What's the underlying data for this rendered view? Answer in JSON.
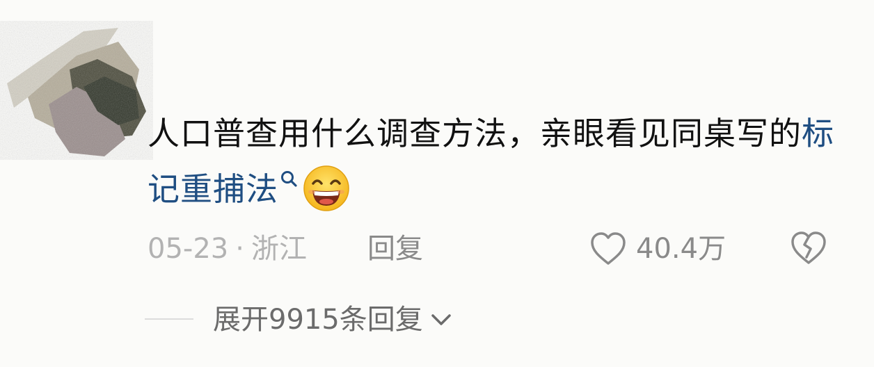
{
  "comment": {
    "text_before": "人口普查用什么调查方法，亲眼看见同桌写的",
    "link_text": "标记重捕法",
    "link_icon": "search-icon",
    "emoji": "grinning-face-emoji"
  },
  "meta": {
    "date": "05-23",
    "separator": "·",
    "location": "浙江"
  },
  "actions": {
    "reply_label": "回复",
    "like_icon": "heart-outline-icon",
    "like_count": "40.4万",
    "dislike_icon": "broken-heart-icon"
  },
  "replies": {
    "expand_label": "展开9915条回复",
    "expand_icon": "chevron-down-icon"
  },
  "colors": {
    "background": "#fbfbf9",
    "text": "#111111",
    "link": "#1f4e82",
    "muted": "#b2b2b2",
    "secondary": "#8a8a8a"
  }
}
